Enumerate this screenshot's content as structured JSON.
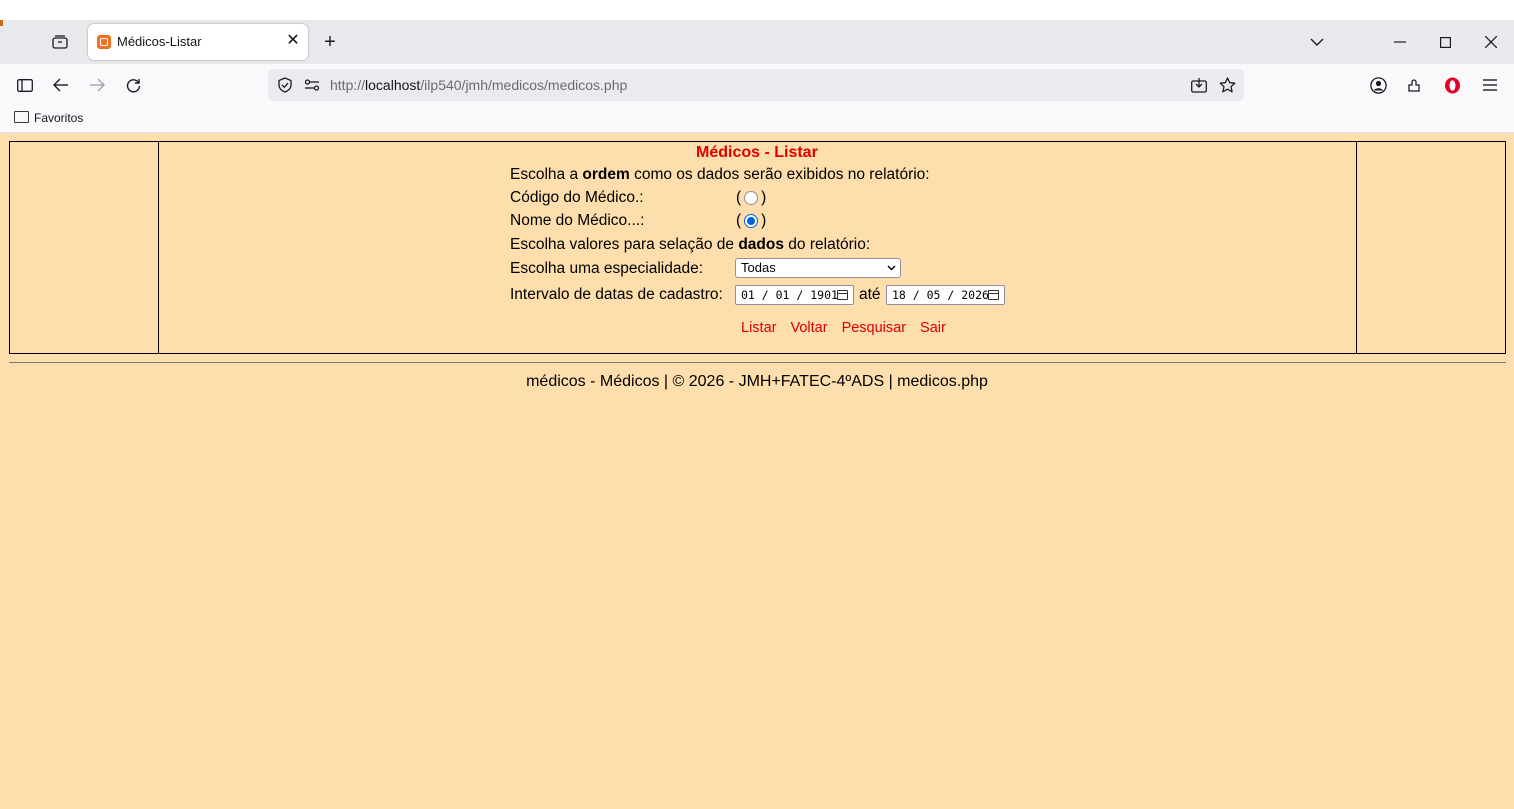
{
  "browser": {
    "tab_title": "Médicos-Listar",
    "url_prefix": "http://",
    "url_host": "localhost",
    "url_path": "/ilp540/jmh/medicos/medicos.php",
    "bookmark_folder": "Favoritos"
  },
  "form": {
    "heading": "Médicos - Listar",
    "order_prefix": "Escolha a ",
    "order_bold": "ordem",
    "order_suffix": " como os dados serão exibidos no relatório:",
    "option_code_label": "Código do Médico.:",
    "option_name_label": "Nome do Médico...:",
    "selected_order": "name",
    "filter_prefix": "Escolha valores para selação de ",
    "filter_bold": "dados",
    "filter_suffix": " do relatório:",
    "specialty_label": "Escolha uma especialidade:",
    "specialty_value": "Todas",
    "date_range_label": "Intervalo de datas de cadastro:",
    "date_from": "01 / 01 / 1901",
    "date_to_label": "até",
    "date_to": "18 / 05 / 2026",
    "paren_open": "(",
    "paren_close": ")",
    "links": [
      "Listar",
      "Voltar",
      "Pesquisar",
      "Sair"
    ]
  },
  "footer": {
    "text": "médicos - Médicos | © 2026 - JMH+FATEC-4ºADS | medicos.php"
  },
  "colors": {
    "page_background": "#fddeac",
    "accent_red": "#e00000",
    "radio_checked": "#0060df"
  }
}
